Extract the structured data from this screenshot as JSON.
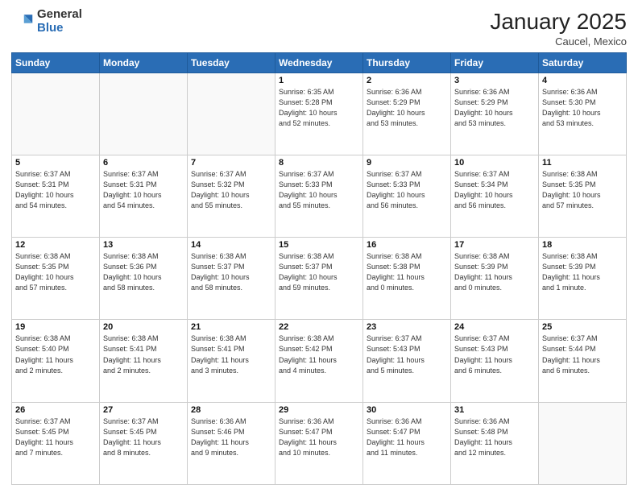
{
  "header": {
    "logo_general": "General",
    "logo_blue": "Blue",
    "month_title": "January 2025",
    "location": "Caucel, Mexico"
  },
  "days_of_week": [
    "Sunday",
    "Monday",
    "Tuesday",
    "Wednesday",
    "Thursday",
    "Friday",
    "Saturday"
  ],
  "weeks": [
    [
      {
        "day": "",
        "info": ""
      },
      {
        "day": "",
        "info": ""
      },
      {
        "day": "",
        "info": ""
      },
      {
        "day": "1",
        "info": "Sunrise: 6:35 AM\nSunset: 5:28 PM\nDaylight: 10 hours\nand 52 minutes."
      },
      {
        "day": "2",
        "info": "Sunrise: 6:36 AM\nSunset: 5:29 PM\nDaylight: 10 hours\nand 53 minutes."
      },
      {
        "day": "3",
        "info": "Sunrise: 6:36 AM\nSunset: 5:29 PM\nDaylight: 10 hours\nand 53 minutes."
      },
      {
        "day": "4",
        "info": "Sunrise: 6:36 AM\nSunset: 5:30 PM\nDaylight: 10 hours\nand 53 minutes."
      }
    ],
    [
      {
        "day": "5",
        "info": "Sunrise: 6:37 AM\nSunset: 5:31 PM\nDaylight: 10 hours\nand 54 minutes."
      },
      {
        "day": "6",
        "info": "Sunrise: 6:37 AM\nSunset: 5:31 PM\nDaylight: 10 hours\nand 54 minutes."
      },
      {
        "day": "7",
        "info": "Sunrise: 6:37 AM\nSunset: 5:32 PM\nDaylight: 10 hours\nand 55 minutes."
      },
      {
        "day": "8",
        "info": "Sunrise: 6:37 AM\nSunset: 5:33 PM\nDaylight: 10 hours\nand 55 minutes."
      },
      {
        "day": "9",
        "info": "Sunrise: 6:37 AM\nSunset: 5:33 PM\nDaylight: 10 hours\nand 56 minutes."
      },
      {
        "day": "10",
        "info": "Sunrise: 6:37 AM\nSunset: 5:34 PM\nDaylight: 10 hours\nand 56 minutes."
      },
      {
        "day": "11",
        "info": "Sunrise: 6:38 AM\nSunset: 5:35 PM\nDaylight: 10 hours\nand 57 minutes."
      }
    ],
    [
      {
        "day": "12",
        "info": "Sunrise: 6:38 AM\nSunset: 5:35 PM\nDaylight: 10 hours\nand 57 minutes."
      },
      {
        "day": "13",
        "info": "Sunrise: 6:38 AM\nSunset: 5:36 PM\nDaylight: 10 hours\nand 58 minutes."
      },
      {
        "day": "14",
        "info": "Sunrise: 6:38 AM\nSunset: 5:37 PM\nDaylight: 10 hours\nand 58 minutes."
      },
      {
        "day": "15",
        "info": "Sunrise: 6:38 AM\nSunset: 5:37 PM\nDaylight: 10 hours\nand 59 minutes."
      },
      {
        "day": "16",
        "info": "Sunrise: 6:38 AM\nSunset: 5:38 PM\nDaylight: 11 hours\nand 0 minutes."
      },
      {
        "day": "17",
        "info": "Sunrise: 6:38 AM\nSunset: 5:39 PM\nDaylight: 11 hours\nand 0 minutes."
      },
      {
        "day": "18",
        "info": "Sunrise: 6:38 AM\nSunset: 5:39 PM\nDaylight: 11 hours\nand 1 minute."
      }
    ],
    [
      {
        "day": "19",
        "info": "Sunrise: 6:38 AM\nSunset: 5:40 PM\nDaylight: 11 hours\nand 2 minutes."
      },
      {
        "day": "20",
        "info": "Sunrise: 6:38 AM\nSunset: 5:41 PM\nDaylight: 11 hours\nand 2 minutes."
      },
      {
        "day": "21",
        "info": "Sunrise: 6:38 AM\nSunset: 5:41 PM\nDaylight: 11 hours\nand 3 minutes."
      },
      {
        "day": "22",
        "info": "Sunrise: 6:38 AM\nSunset: 5:42 PM\nDaylight: 11 hours\nand 4 minutes."
      },
      {
        "day": "23",
        "info": "Sunrise: 6:37 AM\nSunset: 5:43 PM\nDaylight: 11 hours\nand 5 minutes."
      },
      {
        "day": "24",
        "info": "Sunrise: 6:37 AM\nSunset: 5:43 PM\nDaylight: 11 hours\nand 6 minutes."
      },
      {
        "day": "25",
        "info": "Sunrise: 6:37 AM\nSunset: 5:44 PM\nDaylight: 11 hours\nand 6 minutes."
      }
    ],
    [
      {
        "day": "26",
        "info": "Sunrise: 6:37 AM\nSunset: 5:45 PM\nDaylight: 11 hours\nand 7 minutes."
      },
      {
        "day": "27",
        "info": "Sunrise: 6:37 AM\nSunset: 5:45 PM\nDaylight: 11 hours\nand 8 minutes."
      },
      {
        "day": "28",
        "info": "Sunrise: 6:36 AM\nSunset: 5:46 PM\nDaylight: 11 hours\nand 9 minutes."
      },
      {
        "day": "29",
        "info": "Sunrise: 6:36 AM\nSunset: 5:47 PM\nDaylight: 11 hours\nand 10 minutes."
      },
      {
        "day": "30",
        "info": "Sunrise: 6:36 AM\nSunset: 5:47 PM\nDaylight: 11 hours\nand 11 minutes."
      },
      {
        "day": "31",
        "info": "Sunrise: 6:36 AM\nSunset: 5:48 PM\nDaylight: 11 hours\nand 12 minutes."
      },
      {
        "day": "",
        "info": ""
      }
    ]
  ]
}
